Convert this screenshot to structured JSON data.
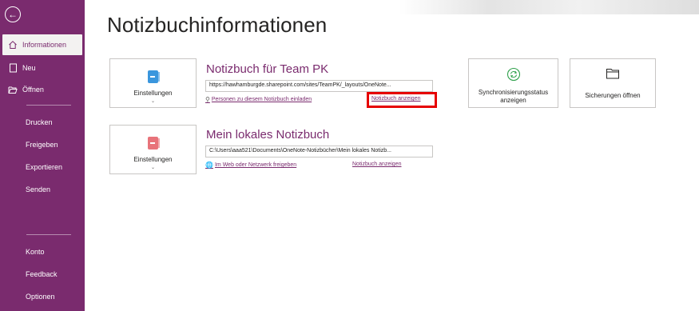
{
  "sidebar": {
    "back_icon": "arrow-left-circle-icon",
    "items": [
      {
        "label": "Informationen",
        "icon": "home-icon"
      },
      {
        "label": "Neu",
        "icon": "new-page-icon"
      },
      {
        "label": "Öffnen",
        "icon": "folder-open-icon"
      }
    ],
    "plain_items": [
      "Drucken",
      "Freigeben",
      "Exportieren",
      "Senden"
    ],
    "bottom_items": [
      "Konto",
      "Feedback",
      "Optionen"
    ]
  },
  "main": {
    "title": "Notizbuchinformationen",
    "notebooks": [
      {
        "settings_label": "Einstellungen",
        "icon_color": "#3a96dd",
        "name": "Notizbuch für Team PK",
        "path": "https://hawhamburgde.sharepoint.com/sites/TeamPK/_layouts/OneNote...",
        "share_link": "Personen zu diesem Notizbuch einladen",
        "view_link": "Notizbuch anzeigen"
      },
      {
        "settings_label": "Einstellungen",
        "icon_color": "#e8737a",
        "name": "Mein lokales Notizbuch",
        "path": "C:\\Users\\aaa521\\Documents\\OneNote-Notizbücher\\Mein lokales Notizb...",
        "share_link": "Im Web oder Netzwerk freigeben",
        "view_link": "Notizbuch anzeigen"
      }
    ],
    "actions": [
      {
        "label": "Synchronisierungsstatus anzeigen",
        "icon": "sync-icon",
        "icon_color": "#2ea04a"
      },
      {
        "label": "Sicherungen öffnen",
        "icon": "folder-icon"
      }
    ]
  },
  "colors": {
    "brand": "#7a2b6e",
    "highlight": "#e60000"
  }
}
